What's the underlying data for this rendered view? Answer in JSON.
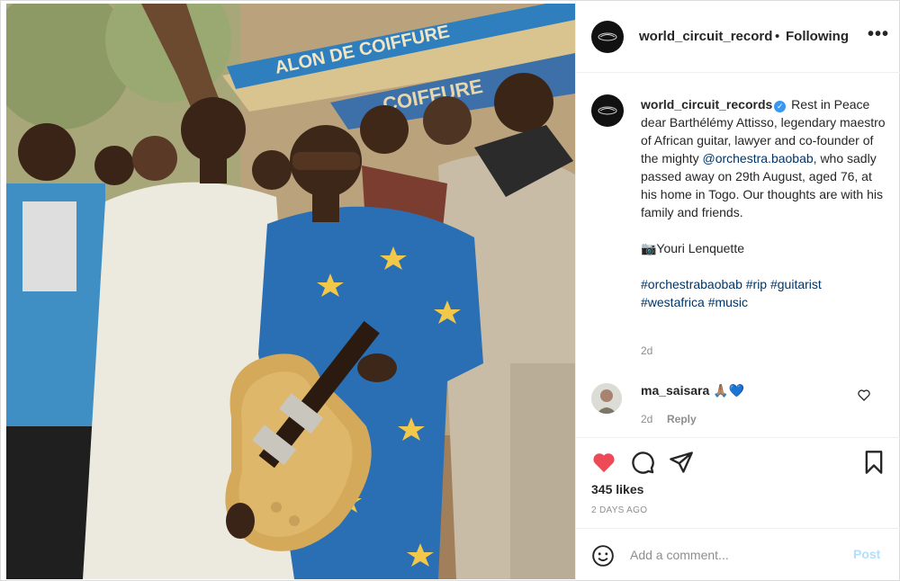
{
  "post": {
    "username": "world_circuit_records",
    "header_separator": "•",
    "follow_status": "Following",
    "more_label": "•••"
  },
  "photo": {
    "sign_text_top": "ALON DE COIFFURE",
    "sign_text_bottom": "COIFFURE"
  },
  "caption": {
    "username": "world_circuit_records",
    "line1": "Rest in Peace dear Barthélémy Attisso, legendary maestro of African guitar, lawyer and co-founder of the mighty",
    "mention": "@orchestra.baobab",
    "line2": ", who sadly passed away on 29th August, aged 76, at his home in Togo. Our thoughts are with his family and friends.",
    "credit": "📷Youri Lenquette",
    "hashtags": "#orchestrabaobab #rip #guitarist #westafrica #music",
    "time": "2d"
  },
  "comment": {
    "username": "ma_saisara",
    "text": "🙏🏽💙",
    "time": "2d",
    "reply_label": "Reply"
  },
  "actions": {
    "likes": "345 likes",
    "posted_ago": "2 DAYS AGO"
  },
  "add_comment": {
    "placeholder": "Add a comment...",
    "post_label": "Post"
  },
  "colors": {
    "like_red": "#ed4956",
    "link_blue": "#003569",
    "post_disabled": "#b2dffc",
    "verified_blue": "#3897f0"
  },
  "icons": {
    "like": "heart-icon",
    "comment": "comment-icon",
    "share": "paper-plane-icon",
    "save": "bookmark-icon",
    "emoji": "smiley-icon",
    "more": "more-options-icon"
  }
}
